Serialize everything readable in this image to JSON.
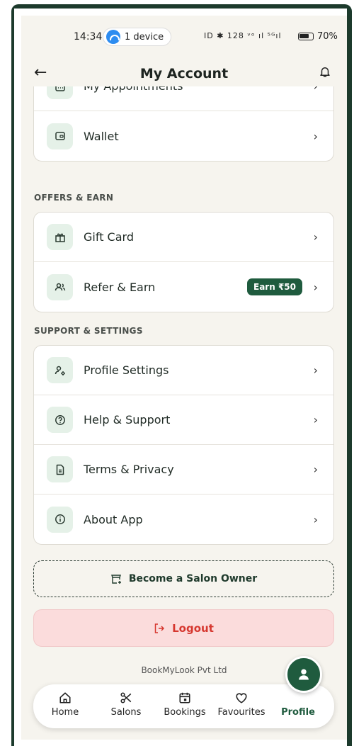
{
  "status": {
    "time": "14:34",
    "device_pill": "1 device",
    "icons_text": "ID ✱ 128 ᵛᵒ ıl ⁵ᴳıl",
    "battery": "70%"
  },
  "header": {
    "title": "My Account"
  },
  "sections": {
    "top_items": [
      {
        "label": "My Appointments",
        "icon": "calendar-icon"
      },
      {
        "label": "Wallet",
        "icon": "wallet-icon"
      }
    ],
    "offers_title": "OFFERS & EARN",
    "offers_items": [
      {
        "label": "Gift Card",
        "icon": "gift-icon"
      },
      {
        "label": "Refer & Earn",
        "icon": "users-icon",
        "badge": "Earn ₹50"
      }
    ],
    "support_title": "SUPPORT & SETTINGS",
    "support_items": [
      {
        "label": "Profile Settings",
        "icon": "user-settings-icon"
      },
      {
        "label": "Help & Support",
        "icon": "help-icon"
      },
      {
        "label": "Terms & Privacy",
        "icon": "document-icon"
      },
      {
        "label": "About App",
        "icon": "info-icon"
      }
    ]
  },
  "actions": {
    "become_owner": "Become a Salon Owner",
    "logout": "Logout"
  },
  "footer": {
    "company": "BookMyLook Pvt Ltd"
  },
  "nav": {
    "items": [
      {
        "label": "Home",
        "icon": "home-icon"
      },
      {
        "label": "Salons",
        "icon": "scissors-icon"
      },
      {
        "label": "Bookings",
        "icon": "calendar-icon"
      },
      {
        "label": "Favourites",
        "icon": "heart-icon"
      },
      {
        "label": "Profile",
        "icon": "person-icon",
        "active": true
      }
    ]
  },
  "colors": {
    "accent": "#1f5b3e",
    "logout_text": "#d6372f",
    "logout_bg": "#fbdcdc",
    "icon_bg": "#e5f1e8",
    "background": "#f6f4ee"
  }
}
